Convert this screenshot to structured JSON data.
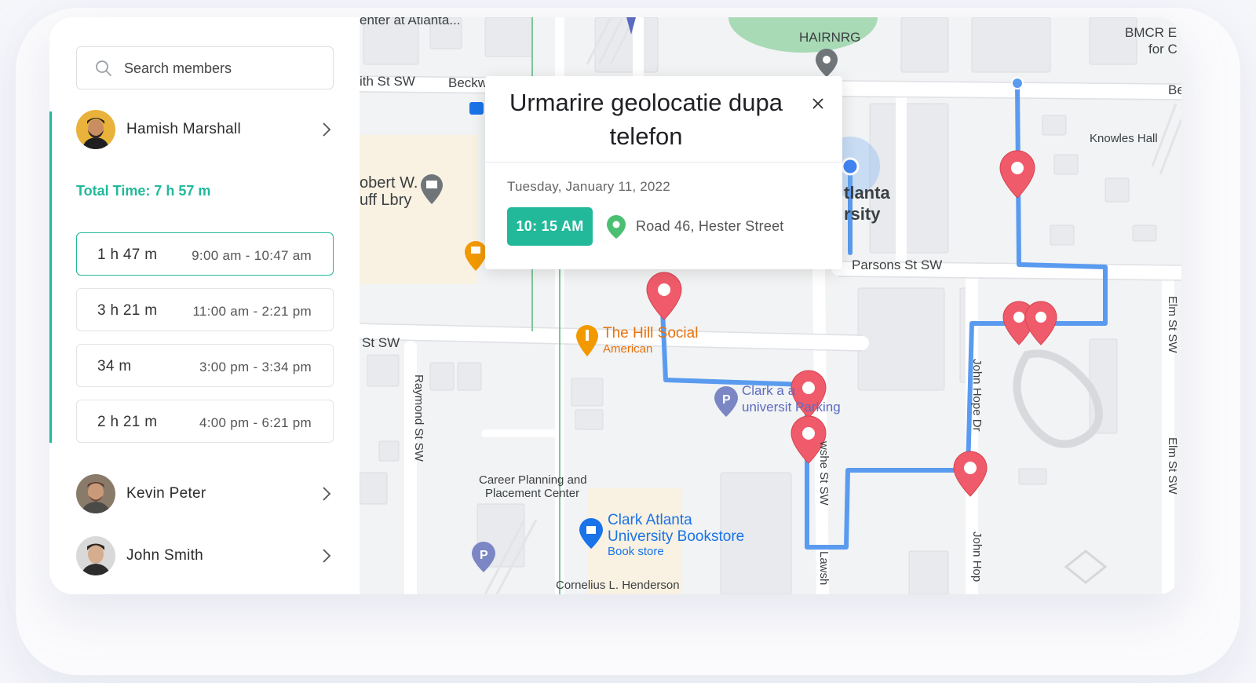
{
  "search": {
    "placeholder": "Search members"
  },
  "members": [
    {
      "name": "Hamish Marshall"
    },
    {
      "name": "Kevin Peter"
    },
    {
      "name": "John Smith"
    }
  ],
  "total_time": "Total Time: 7 h 57 m",
  "slots": [
    {
      "duration": "1 h 47 m",
      "range": "9:00 am - 10:47 am"
    },
    {
      "duration": "3 h 21 m",
      "range": "11:00 am - 2:21 pm"
    },
    {
      "duration": "34 m",
      "range": "3:00 pm - 3:34 pm"
    },
    {
      "duration": "2 h 21 m",
      "range": "4:00 pm - 6:21 pm"
    }
  ],
  "popup": {
    "title": "Urmarire geolocatie dupa telefon",
    "date": "Tuesday, January 11, 2022",
    "time": "10: 15 AM",
    "address": "Road 46, Hester Street"
  },
  "map_labels": {
    "hairnrg": "HAIRNRG",
    "bmcr_1": "BMCR E",
    "bmcr_2": "for C",
    "center_atlanta": "enter at Atlanta...",
    "th_st": "ith St SW",
    "beckw": "Beckw",
    "be": "Be",
    "robert_1": "obert W.",
    "robert_2": "uff Lbry",
    "atlanta_1": "tlanta",
    "atlanta_2": "rsity",
    "knowles": "Knowles Hall",
    "parsons": "Parsons St SW",
    "st_sw": "St SW",
    "hill_social": "The Hill Social",
    "american": "American",
    "clark_parking_1": "Clark a   a",
    "clark_parking_2": "universit  Parking",
    "raymond": "Raymond St SW",
    "career_1": "Career Planning and",
    "career_2": "Placement Center",
    "bookstore_1": "Clark Atlanta",
    "bookstore_2": "University Bookstore",
    "bookstore_3": "Book store",
    "henderson": "Cornelius L. Henderson",
    "lawshe_1": "wshe St SW",
    "lawshe_2": "Lawsh",
    "john_hope_1": "John Hope Dr",
    "john_hope_2": "John Hop",
    "elm_1": "Elm St SW",
    "elm_2": "Elm St SW"
  },
  "colors": {
    "accent": "#21b99a",
    "route": "#5a9bef",
    "marker": "#ef5b6a",
    "park": "#a8dab5"
  },
  "icons": {
    "search": "search-icon",
    "chevron": "chevron-right-icon",
    "close": "close-icon",
    "location": "map-pin-icon"
  }
}
